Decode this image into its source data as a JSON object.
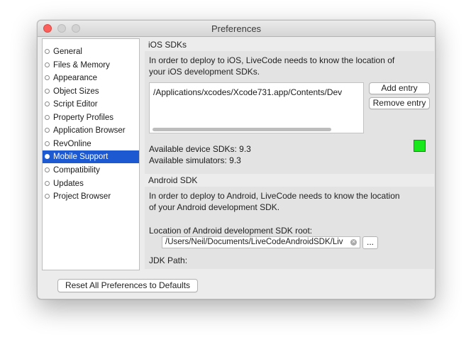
{
  "window": {
    "title": "Preferences",
    "controls": [
      "close",
      "minimize",
      "maximize"
    ]
  },
  "sidebar": {
    "items": [
      {
        "label": "General",
        "selected": false
      },
      {
        "label": "Files & Memory",
        "selected": false
      },
      {
        "label": "Appearance",
        "selected": false
      },
      {
        "label": "Object Sizes",
        "selected": false
      },
      {
        "label": "Script Editor",
        "selected": false
      },
      {
        "label": "Property Profiles",
        "selected": false
      },
      {
        "label": "Application Browser",
        "selected": false
      },
      {
        "label": "RevOnline",
        "selected": false
      },
      {
        "label": "Mobile Support",
        "selected": true
      },
      {
        "label": "Compatibility",
        "selected": false
      },
      {
        "label": "Updates",
        "selected": false
      },
      {
        "label": "Project Browser",
        "selected": false
      }
    ]
  },
  "ios": {
    "heading": "iOS SDKs",
    "description_line1": "In order to deploy to iOS, LiveCode needs to know the location of",
    "description_line2": "your iOS development SDKs.",
    "sdk_list": [
      "/Applications/xcodes/Xcode731.app/Contents/Dev"
    ],
    "add_label": "Add entry",
    "remove_label": "Remove entry",
    "device_sdks": "Available device SDKs: 9.3",
    "simulators": "Available simulators: 9.3",
    "status_color": "#19e81c"
  },
  "android": {
    "heading": "Android SDK",
    "description_line1": "In order to deploy to Android, LiveCode needs to know the location",
    "description_line2": "of your Android development SDK.",
    "sdk_root_label": "Location of Android development SDK root:",
    "sdk_root_value": "/Users/Neil/Documents/LiveCodeAndroidSDK/Liv",
    "browse_label": "...",
    "jdk_label": "JDK Path:"
  },
  "footer": {
    "reset_label": "Reset All Preferences to Defaults"
  },
  "icons": {
    "clear": "clear-circle-icon",
    "bullet": "radio-bullet-icon"
  },
  "colors": {
    "selection": "#1d5ad1",
    "close_button": "#fc605c"
  }
}
